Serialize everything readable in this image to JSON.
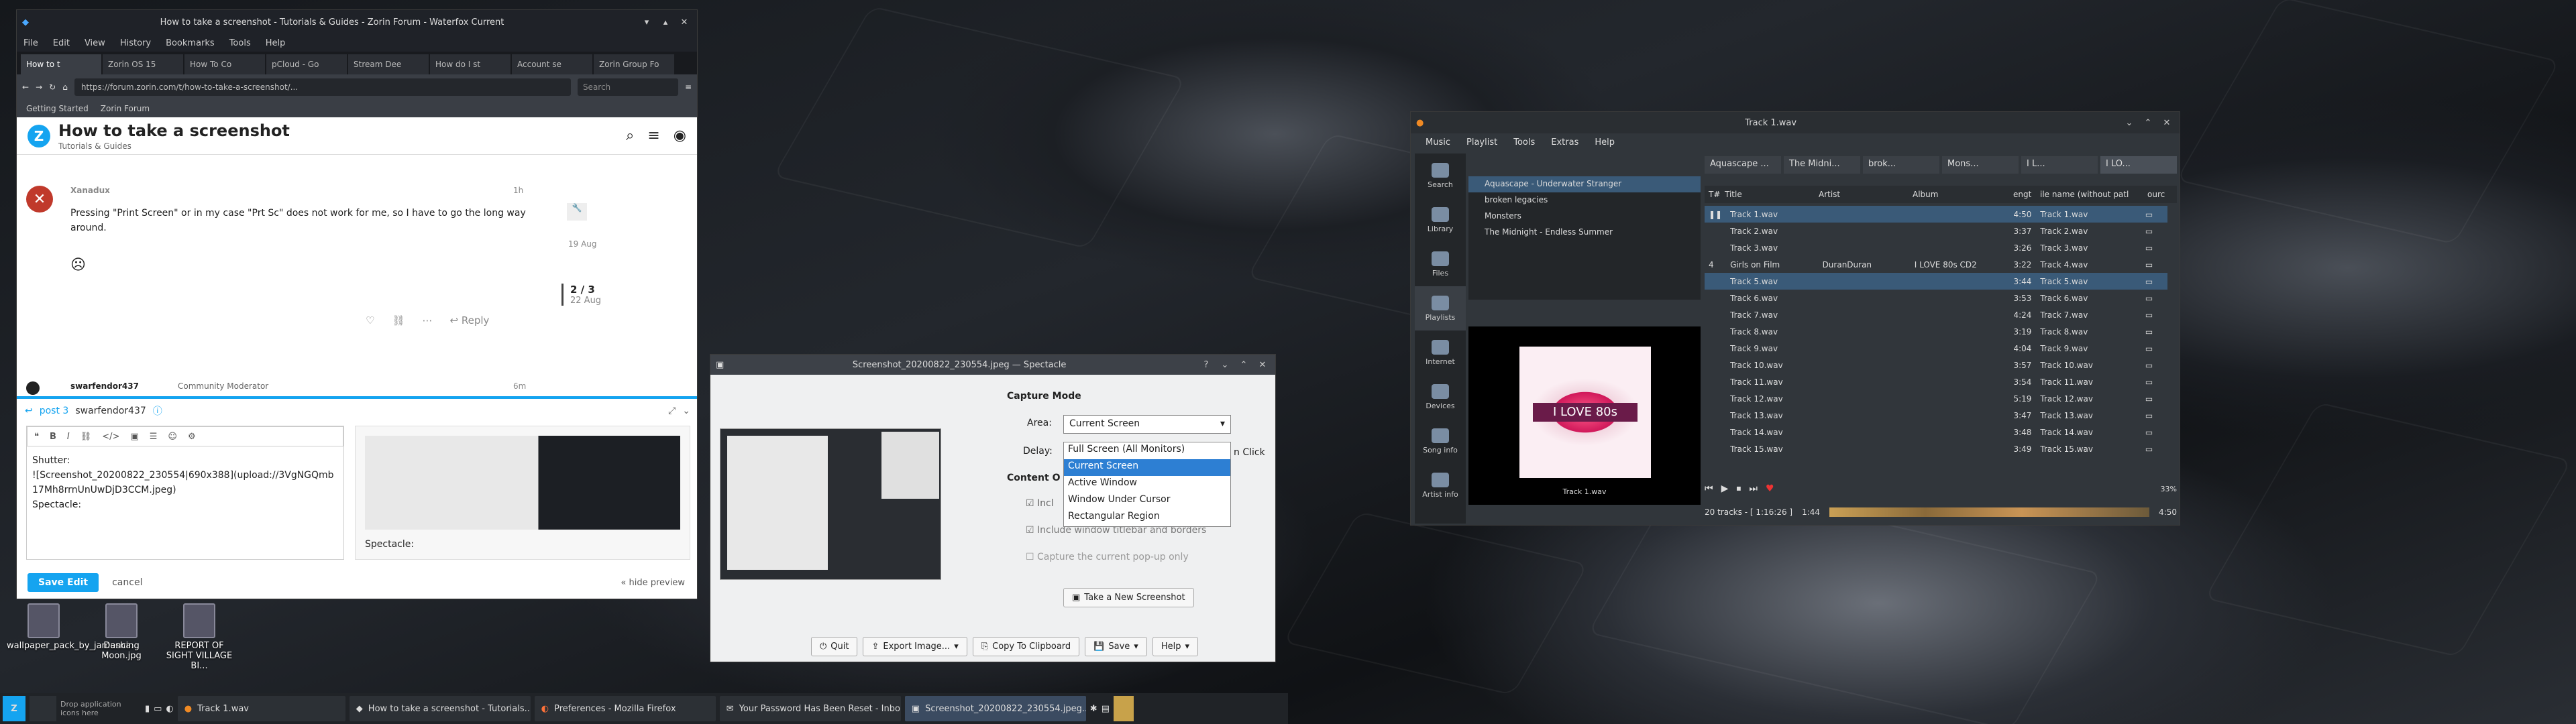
{
  "firefox": {
    "title": "How to take a screenshot - Tutorials & Guides - Zorin Forum - Waterfox Current",
    "menu": [
      "File",
      "Edit",
      "View",
      "History",
      "Bookmarks",
      "Tools",
      "Help"
    ],
    "tabs": [
      "How to t",
      "Zorin OS 15",
      "How To Co",
      "pCloud - Go",
      "Stream Dee",
      "How do I st",
      "Account se",
      "Zorin Group Fo"
    ],
    "url": "https://forum.zorin.com/t/how-to-take-a-screenshot/...",
    "search_placeholder": "Search",
    "bookmarks": [
      "Getting Started",
      "Zorin Forum"
    ],
    "page_title": "How to take a screenshot",
    "category": "Tutorials & Guides",
    "post_user": "Xanadux",
    "post_age": "1h",
    "post_text": "Pressing \"Print Screen\" or in my case \"Prt Sc\" does not work for me, so I have to go the long way around.",
    "reply_label": "Reply",
    "date1": "19 Aug",
    "progress": "2 / 3",
    "date2": "22 Aug",
    "mod_user": "swarfendor437",
    "mod_role": "Community Moderator",
    "mod_age": "6m",
    "composer_post": "post 3",
    "composer_user": "swarfendor437",
    "composer_text": [
      "Shutter:",
      "![Screenshot_20200822_230554|690x388](upload://3VgNGQmb17Mh8rrnUnUwDjD3CCM.jpeg)",
      "Spectacle:"
    ],
    "preview_text": "Spectacle:",
    "save_edit": "Save Edit",
    "cancel": "cancel",
    "hide_preview": "« hide preview"
  },
  "spectacle": {
    "title": "Screenshot_20200822_230554.jpeg — Spectacle",
    "capture_mode": "Capture Mode",
    "area_label": "Area:",
    "area_value": "Current Screen",
    "delay_label": "Delay:",
    "content_label": "Content O",
    "options": [
      "Full Screen (All Monitors)",
      "Current Screen",
      "Active Window",
      "Window Under Cursor",
      "Rectangular Region"
    ],
    "opt_click": "n Click",
    "chk_incl": "Incl",
    "chk_titlebar": "Include window titlebar and borders",
    "chk_popup": "Capture the current pop-up only",
    "take_new": "Take a New Screenshot",
    "quit": "Quit",
    "export": "Export Image...",
    "copy": "Copy To Clipboard",
    "save": "Save",
    "help": "Help"
  },
  "clementine": {
    "title": "Track 1.wav",
    "menu": [
      "Music",
      "Playlist",
      "Tools",
      "Extras",
      "Help"
    ],
    "side": [
      "Search",
      "Library",
      "Files",
      "Playlists",
      "Internet",
      "Devices",
      "Song info",
      "Artist info"
    ],
    "library": [
      "Aquascape - Underwater Stranger",
      "broken legacies",
      "Monsters",
      "The Midnight - Endless Summer"
    ],
    "tabs": [
      "Aquascape ...",
      "The Midni...",
      "brok...",
      "Mons...",
      "I L...",
      "I LO..."
    ],
    "headers": [
      "T#",
      "Title",
      "Artist",
      "Album",
      "engt",
      "ile name (without patl",
      "ourc"
    ],
    "tracks": [
      [
        "",
        "Track 1.wav",
        "",
        "",
        "4:50",
        "Track 1.wav"
      ],
      [
        "",
        "Track 2.wav",
        "",
        "",
        "3:37",
        "Track 2.wav"
      ],
      [
        "",
        "Track 3.wav",
        "",
        "",
        "3:26",
        "Track 3.wav"
      ],
      [
        "4",
        "Girls on Film",
        "DuranDuran",
        "I LOVE 80s CD2",
        "3:22",
        "Track 4.wav"
      ],
      [
        "",
        "Track 5.wav",
        "",
        "",
        "3:44",
        "Track 5.wav"
      ],
      [
        "",
        "Track 6.wav",
        "",
        "",
        "3:53",
        "Track 6.wav"
      ],
      [
        "",
        "Track 7.wav",
        "",
        "",
        "4:24",
        "Track 7.wav"
      ],
      [
        "",
        "Track 8.wav",
        "",
        "",
        "3:19",
        "Track 8.wav"
      ],
      [
        "",
        "Track 9.wav",
        "",
        "",
        "4:04",
        "Track 9.wav"
      ],
      [
        "",
        "Track 10.wav",
        "",
        "",
        "3:57",
        "Track 10.wav"
      ],
      [
        "",
        "Track 11.wav",
        "",
        "",
        "3:54",
        "Track 11.wav"
      ],
      [
        "",
        "Track 12.wav",
        "",
        "",
        "5:19",
        "Track 12.wav"
      ],
      [
        "",
        "Track 13.wav",
        "",
        "",
        "3:47",
        "Track 13.wav"
      ],
      [
        "",
        "Track 14.wav",
        "",
        "",
        "3:48",
        "Track 14.wav"
      ],
      [
        "",
        "Track 15.wav",
        "",
        "",
        "3:49",
        "Track 15.wav"
      ]
    ],
    "album_caption": "Track 1.wav",
    "album_text": "I LOVE 80s",
    "status": "20 tracks - [ 1:16:26 ]",
    "time_cur": "1:44",
    "time_total": "4:50",
    "volume": "33%"
  },
  "desktop": {
    "icons": [
      "wallpaper_pack_by_jamesha...",
      "Dancing Moon.jpg",
      "REPORT OF SIGHT VILLAGE BI..."
    ]
  },
  "taskbar": {
    "drop_text": "Drop application icons here",
    "tasks": [
      "Track 1.wav",
      "How to take a screenshot - Tutorials...",
      "Preferences - Mozilla Firefox",
      "Your Password Has Been Reset - Inbo...",
      "Screenshot_20200822_230554.jpeg..."
    ]
  }
}
